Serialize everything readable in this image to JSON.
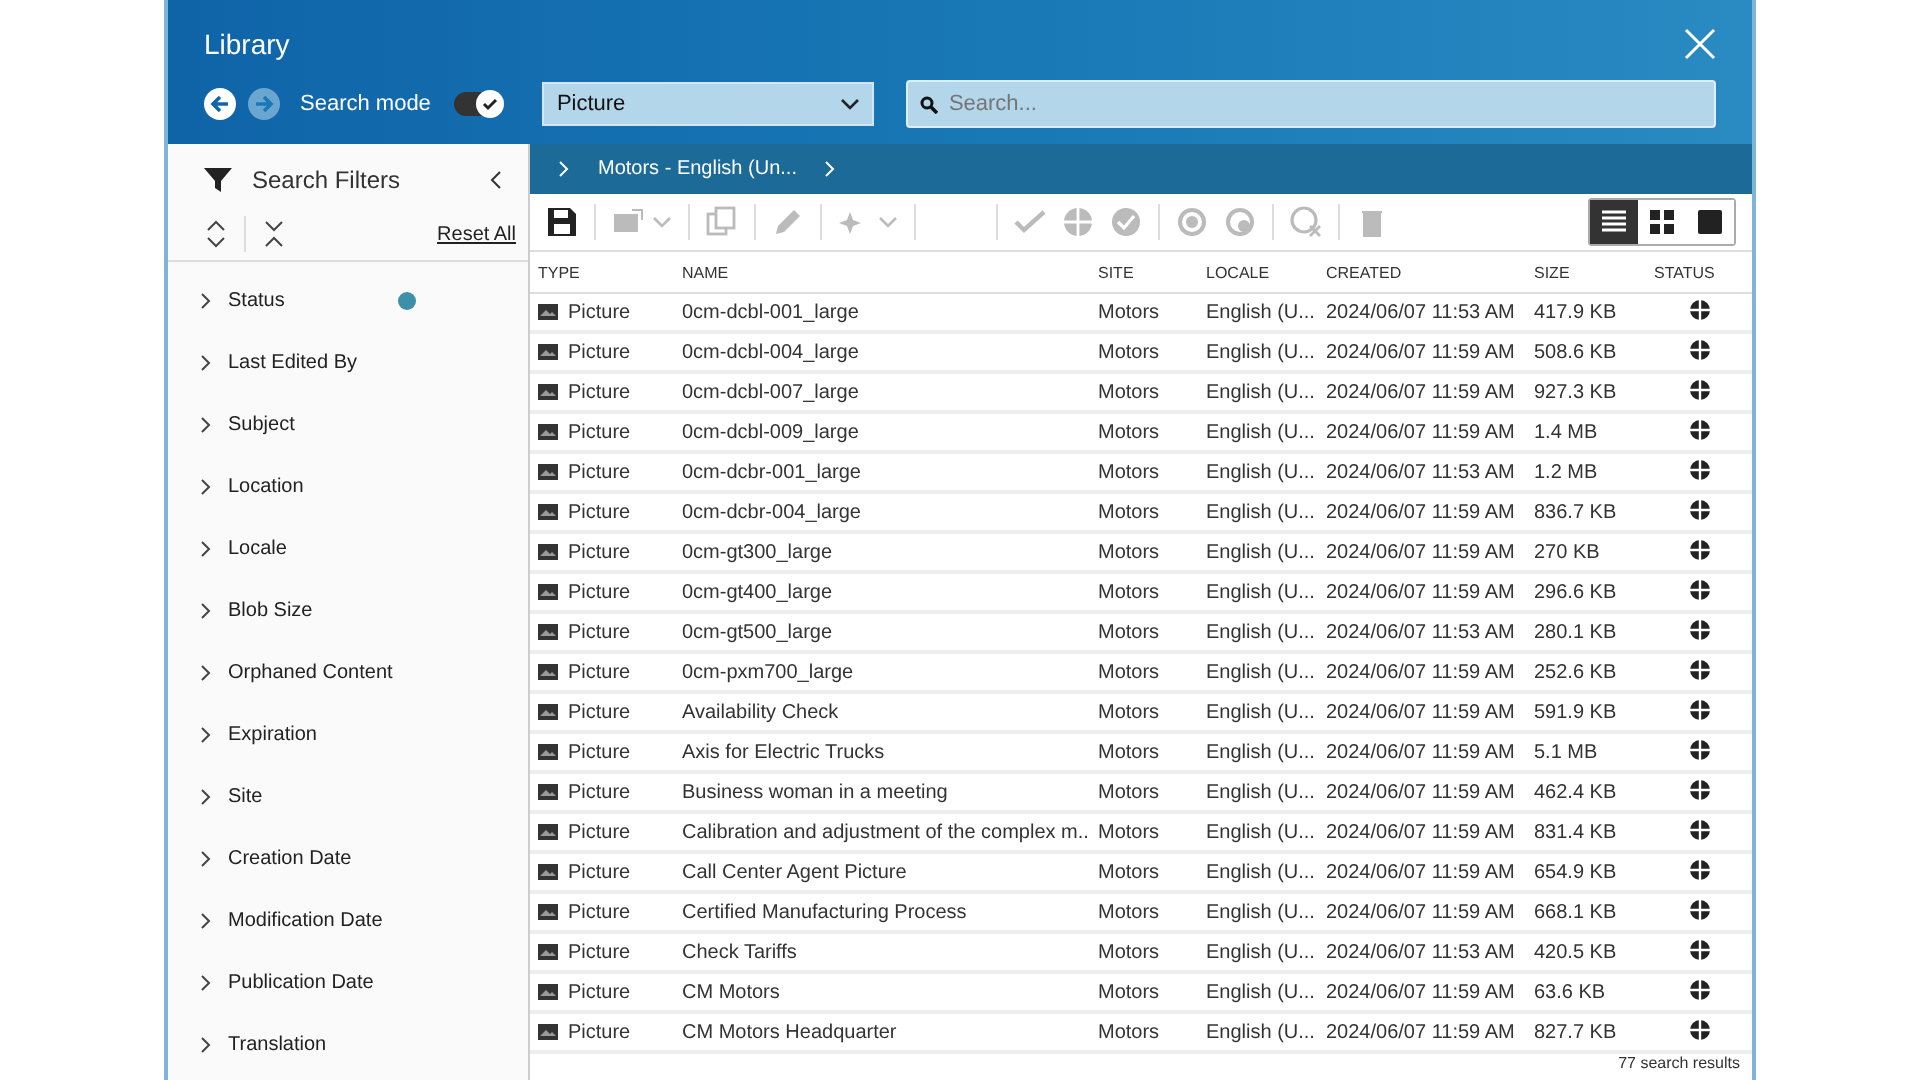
{
  "window": {
    "title": "Library"
  },
  "search_mode": {
    "label": "Search mode",
    "on": true
  },
  "type_select": {
    "value": "Picture"
  },
  "search": {
    "placeholder": "Search..."
  },
  "breadcrumb": {
    "label": "Motors - English (Un..."
  },
  "sidebar": {
    "title": "Search Filters",
    "reset": "Reset All",
    "items": [
      {
        "label": "Status",
        "badge": true
      },
      {
        "label": "Last Edited By",
        "badge": false
      },
      {
        "label": "Subject",
        "badge": false
      },
      {
        "label": "Location",
        "badge": false
      },
      {
        "label": "Locale",
        "badge": false
      },
      {
        "label": "Blob Size",
        "badge": false
      },
      {
        "label": "Orphaned Content",
        "badge": false
      },
      {
        "label": "Expiration",
        "badge": false
      },
      {
        "label": "Site",
        "badge": false
      },
      {
        "label": "Creation Date",
        "badge": false
      },
      {
        "label": "Modification Date",
        "badge": false
      },
      {
        "label": "Publication Date",
        "badge": false
      },
      {
        "label": "Translation",
        "badge": false
      }
    ]
  },
  "views": [
    {
      "kind": "list",
      "selected": true
    },
    {
      "kind": "grid",
      "selected": false
    },
    {
      "kind": "card",
      "selected": false
    }
  ],
  "table": {
    "columns": [
      "TYPE",
      "NAME",
      "SITE",
      "LOCALE",
      "CREATED",
      "SIZE",
      "STATUS"
    ],
    "rows": [
      [
        "Picture",
        "0cm-dcbl-001_large",
        "Motors",
        "English (U...",
        "2024/06/07 11:53 AM",
        "417.9 KB"
      ],
      [
        "Picture",
        "0cm-dcbl-004_large",
        "Motors",
        "English (U...",
        "2024/06/07 11:59 AM",
        "508.6 KB"
      ],
      [
        "Picture",
        "0cm-dcbl-007_large",
        "Motors",
        "English (U...",
        "2024/06/07 11:59 AM",
        "927.3 KB"
      ],
      [
        "Picture",
        "0cm-dcbl-009_large",
        "Motors",
        "English (U...",
        "2024/06/07 11:59 AM",
        "1.4 MB"
      ],
      [
        "Picture",
        "0cm-dcbr-001_large",
        "Motors",
        "English (U...",
        "2024/06/07 11:53 AM",
        "1.2 MB"
      ],
      [
        "Picture",
        "0cm-dcbr-004_large",
        "Motors",
        "English (U...",
        "2024/06/07 11:59 AM",
        "836.7 KB"
      ],
      [
        "Picture",
        "0cm-gt300_large",
        "Motors",
        "English (U...",
        "2024/06/07 11:59 AM",
        "270 KB"
      ],
      [
        "Picture",
        "0cm-gt400_large",
        "Motors",
        "English (U...",
        "2024/06/07 11:59 AM",
        "296.6 KB"
      ],
      [
        "Picture",
        "0cm-gt500_large",
        "Motors",
        "English (U...",
        "2024/06/07 11:53 AM",
        "280.1 KB"
      ],
      [
        "Picture",
        "0cm-pxm700_large",
        "Motors",
        "English (U...",
        "2024/06/07 11:59 AM",
        "252.6 KB"
      ],
      [
        "Picture",
        "Availability Check",
        "Motors",
        "English (U...",
        "2024/06/07 11:59 AM",
        "591.9 KB"
      ],
      [
        "Picture",
        "Axis for Electric Trucks",
        "Motors",
        "English (U...",
        "2024/06/07 11:59 AM",
        "5.1 MB"
      ],
      [
        "Picture",
        "Business woman in a meeting",
        "Motors",
        "English (U...",
        "2024/06/07 11:59 AM",
        "462.4 KB"
      ],
      [
        "Picture",
        "Calibration and adjustment of the complex m...",
        "Motors",
        "English (U...",
        "2024/06/07 11:59 AM",
        "831.4 KB"
      ],
      [
        "Picture",
        "Call Center Agent Picture",
        "Motors",
        "English (U...",
        "2024/06/07 11:59 AM",
        "654.9 KB"
      ],
      [
        "Picture",
        "Certified Manufacturing Process",
        "Motors",
        "English (U...",
        "2024/06/07 11:59 AM",
        "668.1 KB"
      ],
      [
        "Picture",
        "Check Tariffs",
        "Motors",
        "English (U...",
        "2024/06/07 11:53 AM",
        "420.5 KB"
      ],
      [
        "Picture",
        "CM Motors",
        "Motors",
        "English (U...",
        "2024/06/07 11:59 AM",
        "63.6 KB"
      ],
      [
        "Picture",
        "CM Motors Headquarter",
        "Motors",
        "English (U...",
        "2024/06/07 11:59 AM",
        "827.7 KB"
      ]
    ]
  },
  "status_bar": {
    "text": "77 search results"
  }
}
